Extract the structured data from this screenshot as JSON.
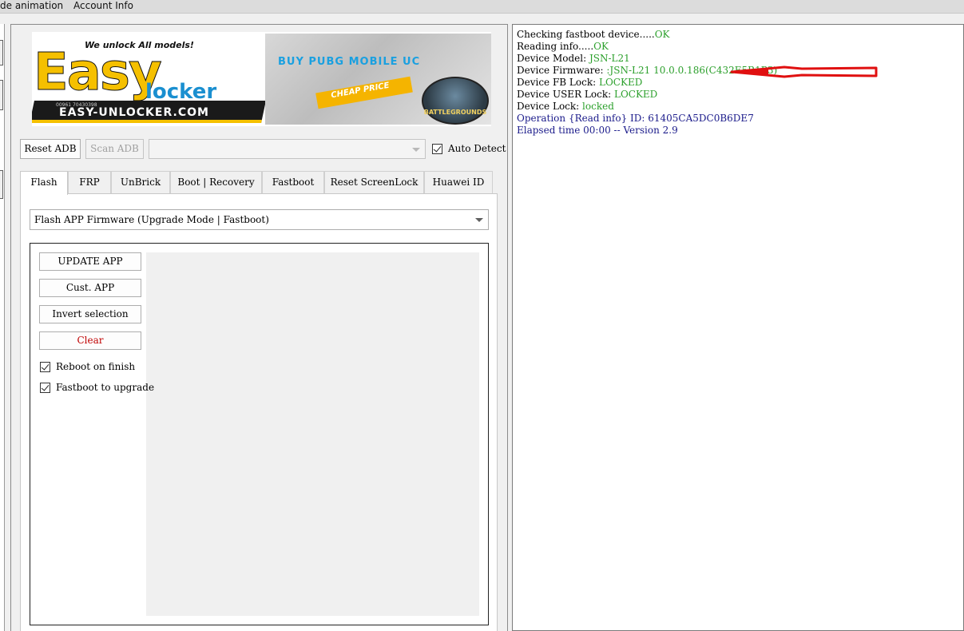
{
  "menubar": {
    "items": [
      "de animation",
      "Account Info"
    ]
  },
  "banner": {
    "tagline": "We unlock All models!",
    "brand_big": "Easy",
    "brand_small": "locker",
    "url": "EASY-UNLOCKER.COM",
    "phone": "00961 70430398",
    "promo_title": "BUY PUBG MOBILE UC",
    "promo_cheap": "CHEAP PRICE",
    "promo_game": "BATTLEGROUNDS"
  },
  "toolbar": {
    "reset_adb": "Reset ADB",
    "scan_adb": "Scan ADB",
    "device_combo_value": "",
    "auto_detect": "Auto Detect"
  },
  "tabs": [
    {
      "label": "Flash",
      "active": true
    },
    {
      "label": "FRP",
      "active": false
    },
    {
      "label": "UnBrick",
      "active": false
    },
    {
      "label": "Boot | Recovery",
      "active": false
    },
    {
      "label": "Fastboot",
      "active": false
    },
    {
      "label": "Reset ScreenLock",
      "active": false
    },
    {
      "label": "Huawei ID",
      "active": false
    }
  ],
  "flash": {
    "mode_select": "Flash APP Firmware (Upgrade Mode | Fastboot)",
    "update_app": "UPDATE APP",
    "cust_app": "Cust. APP",
    "invert_selection": "Invert selection",
    "clear": "Clear",
    "reboot_on_finish": "Reboot on finish",
    "fastboot_to_upgrade": "Fastboot to upgrade"
  },
  "log": [
    {
      "label": "Checking fastboot device.....",
      "value": "OK"
    },
    {
      "label": "Reading info.....",
      "value": "OK"
    },
    {
      "label": "Device Model: ",
      "value": "JSN-L21"
    },
    {
      "label": "Device Firmware: ",
      "value": ":JSN-L21 10.0.0.186(C432E5R1P3)"
    },
    {
      "label": "Device FB Lock: ",
      "value": "LOCKED"
    },
    {
      "label": "Device USER Lock: ",
      "value": "LOCKED"
    },
    {
      "label": "Device Lock: ",
      "value": "locked"
    },
    {
      "label": "Operation {Read info} ID: 61405CA5DC0B6DE7",
      "value": ""
    },
    {
      "label": "Elapsed time 00:00 -- Version 2.9",
      "value": ""
    }
  ],
  "colors": {
    "log_ok": "#2ca02c",
    "log_info": "#1a1a8a",
    "clear_red": "#c00000",
    "annotation_arrow": "#e01010"
  }
}
